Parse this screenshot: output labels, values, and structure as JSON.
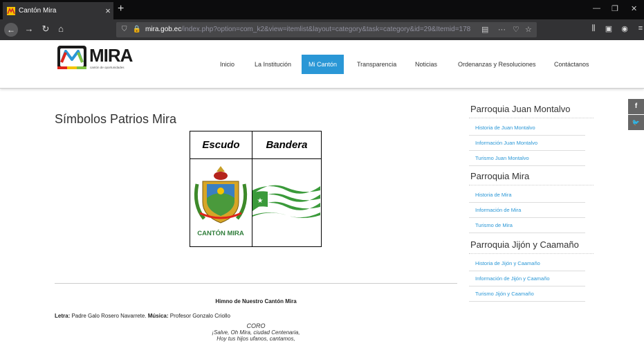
{
  "browser": {
    "tab_title": "Cantón Mira",
    "tab_close": "×",
    "new_tab": "+",
    "url_domain": "mira.gob.ec",
    "url_path": "/index.php?option=com_k2&view=itemlist&layout=category&task=category&id=29&Itemid=178",
    "icons": [
      "back-icon",
      "forward-icon",
      "reload-icon",
      "home-icon",
      "shield-icon",
      "reader-icon",
      "more-icon",
      "pocket-icon",
      "bookmark-icon",
      "library-icon",
      "sidebar-icon",
      "account-icon",
      "menu-icon"
    ]
  },
  "site": {
    "logo_text": "MIRA",
    "logo_tagline": "cantón de oportunidades",
    "menu": [
      {
        "label": "Inicio"
      },
      {
        "label": "La Institución"
      },
      {
        "label": "Mi Cantón"
      },
      {
        "label": "Transparencia"
      },
      {
        "label": "Noticias"
      },
      {
        "label": "Ordenanzas y Resoluciones"
      },
      {
        "label": "Contáctanos"
      }
    ],
    "accent_color": "#2a97d6"
  },
  "main": {
    "title": "Símbolos Patrios Mira",
    "table_headers": [
      "Escudo",
      "Bandera"
    ],
    "shield_caption": "CANTÓN MIRA",
    "anthem_title": "Himno de Nuestro Cantón Mira",
    "credits_letra_label": "Letra:",
    "credits_letra": " Padre Galo Rosero Navarrete. ",
    "credits_musica_label": "Música:",
    "credits_musica": " Profesor Gonzalo Criollo",
    "coro_title": "CORO",
    "coro_lines": [
      "¡Salve, Oh Mira, ciudad Centenaria,",
      "Hoy tus hijos ufanos, cantamos,"
    ]
  },
  "sidebar": {
    "sections": [
      {
        "heading": "Parroquia Juan Montalvo",
        "links": [
          "Historia de Juan Montalvo",
          "Información Juan Montalvo",
          "Turismo Juan Montalvo"
        ]
      },
      {
        "heading": "Parroquia Mira",
        "links": [
          "Historia de Mira",
          "Información de Mira",
          "Turismo de Mira"
        ]
      },
      {
        "heading": "Parroquia Jijón y Caamaño",
        "links": [
          "Historia de Jijón y Caamaño",
          "Información de Jijón y Caamaño",
          "Turismo Jijón y Caamaño"
        ]
      }
    ]
  },
  "social": {
    "facebook": "f",
    "twitter": "t"
  }
}
